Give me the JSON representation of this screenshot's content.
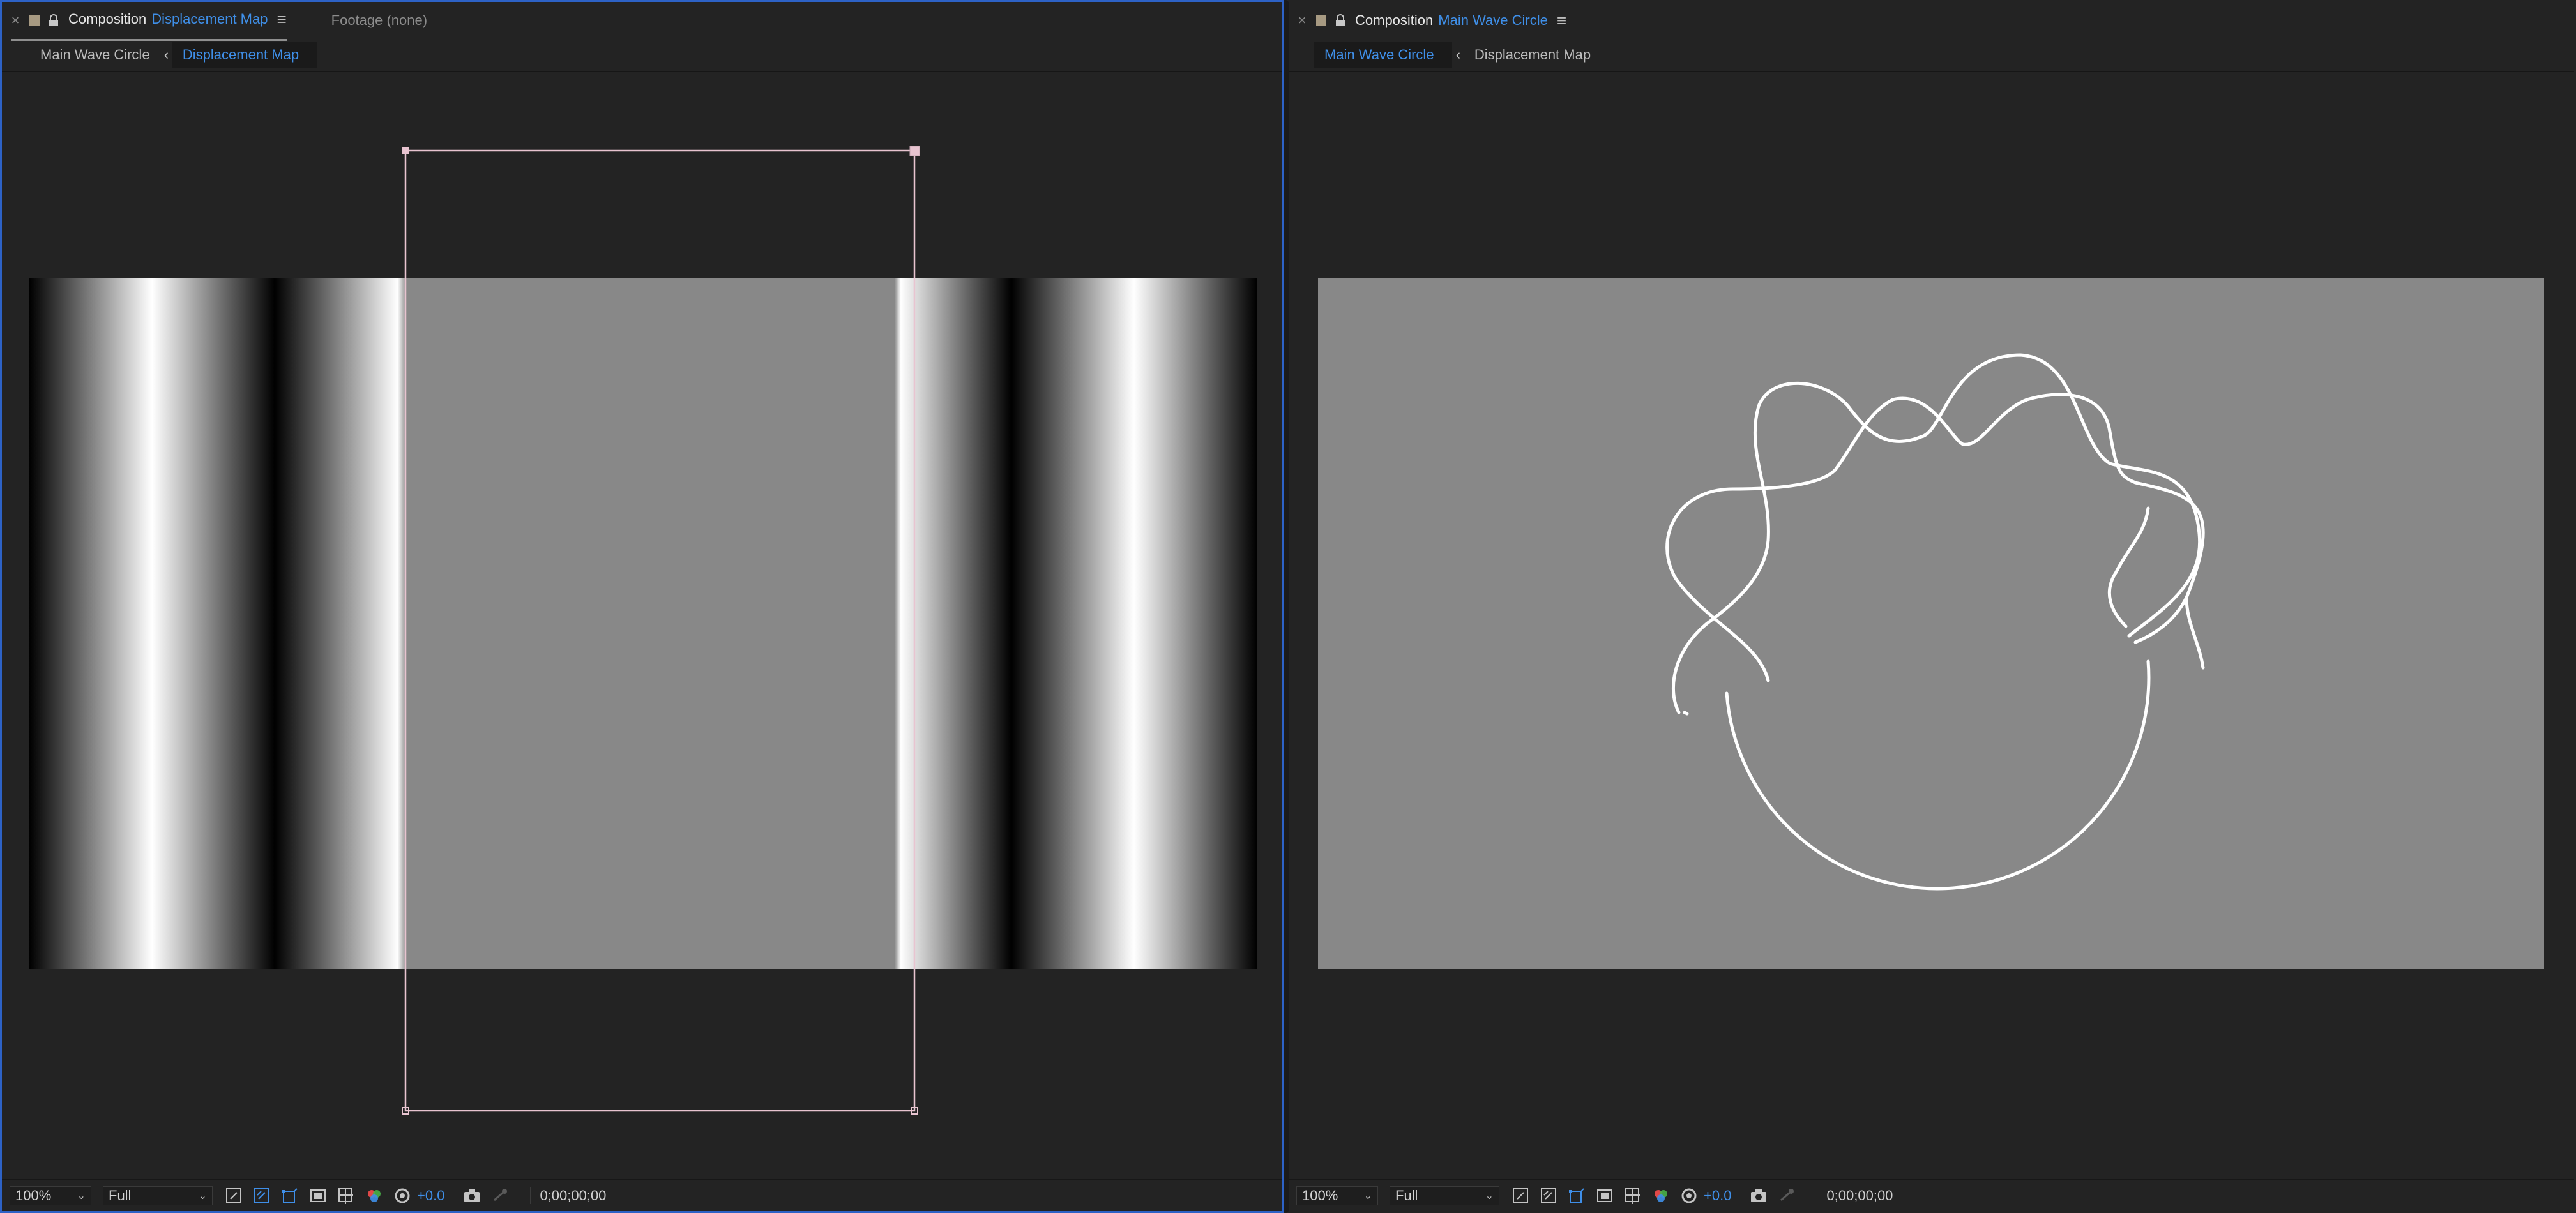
{
  "left_panel": {
    "tab_close": "×",
    "tab_prefix": "Composition",
    "tab_name": "Displacement Map",
    "tab_menu": "≡",
    "footage_tab": "Footage (none)",
    "breadcrumbs": [
      "Main Wave Circle",
      "Displacement Map"
    ],
    "breadcrumb_sep": "‹",
    "zoom": "100%",
    "resolution": "Full",
    "exposure": "+0.0",
    "timecode": "0;00;00;00"
  },
  "right_panel": {
    "tab_close": "×",
    "tab_prefix": "Composition",
    "tab_name": "Main Wave Circle",
    "tab_menu": "≡",
    "breadcrumbs": [
      "Main Wave Circle",
      "Displacement Map"
    ],
    "breadcrumb_sep": "‹",
    "zoom": "100%",
    "resolution": "Full",
    "exposure": "+0.0",
    "timecode": "0;00;00;00"
  },
  "colors": {
    "accent": "#3f8fe8",
    "panel_bg": "#232323",
    "active_border": "#2d62c6",
    "comp_gray": "#888888",
    "layer_bounds": "#e8c4d0"
  },
  "icons": [
    "close-icon",
    "color-swatch-icon",
    "lock-icon",
    "panel-menu-icon",
    "chevron-left-icon",
    "chevron-down-icon",
    "region-of-interest-icon",
    "transparency-grid-icon",
    "mask-visibility-icon",
    "fast-preview-icon",
    "guides-icon",
    "channel-icon",
    "exposure-reset-icon",
    "snapshot-camera-icon",
    "show-snapshot-icon"
  ]
}
